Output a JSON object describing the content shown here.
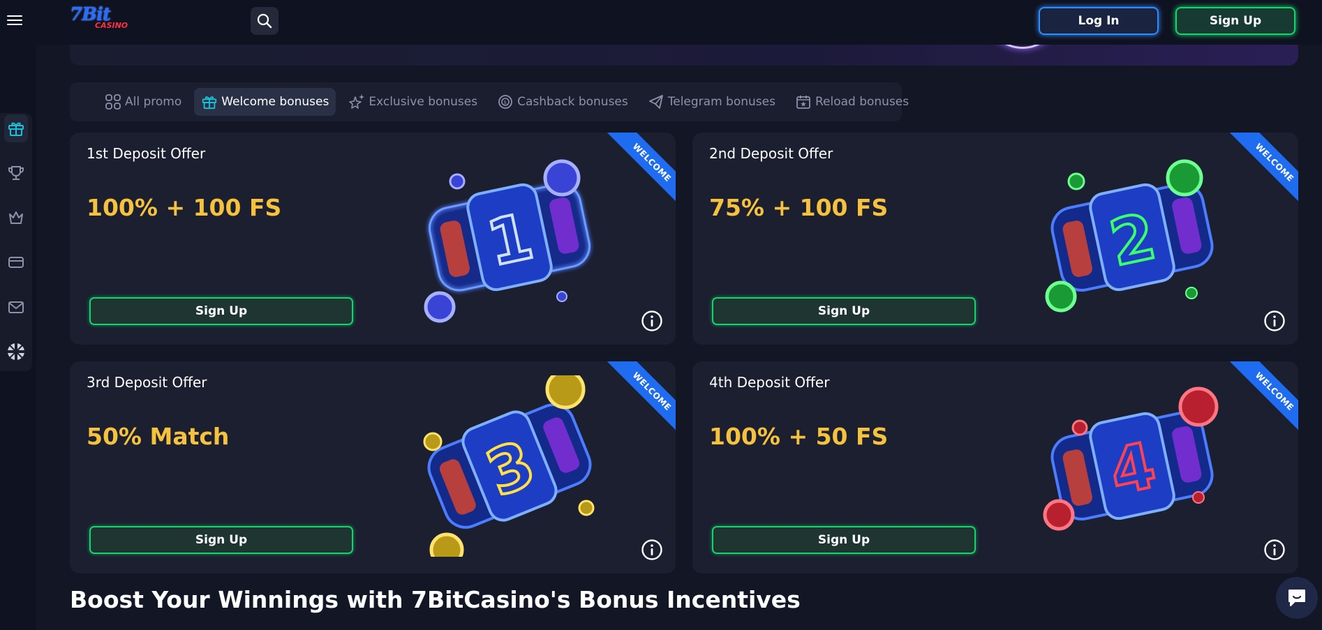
{
  "header": {
    "logo_text": "7Bit",
    "logo_sub": "CASINO",
    "login_label": "Log In",
    "signup_label": "Sign Up"
  },
  "tabs": [
    {
      "label": "All promo",
      "icon": "grid-icon",
      "active": false
    },
    {
      "label": "Welcome bonuses",
      "icon": "gift-icon",
      "active": true
    },
    {
      "label": "Exclusive bonuses",
      "icon": "star-sparkle-icon",
      "active": false
    },
    {
      "label": "Cashback bonuses",
      "icon": "cashback-icon",
      "active": false
    },
    {
      "label": "Telegram bonuses",
      "icon": "telegram-icon",
      "active": false
    },
    {
      "label": "Reload bonuses",
      "icon": "calendar-icon",
      "active": false
    }
  ],
  "cards": [
    {
      "title": "1st Deposit Offer",
      "amount": "100% + 100 FS",
      "button": "Sign Up",
      "ribbon": "WELCOME",
      "digit": "1",
      "color": "#3b5cff"
    },
    {
      "title": "2nd Deposit Offer",
      "amount": "75% + 100 FS",
      "button": "Sign Up",
      "ribbon": "WELCOME",
      "digit": "2",
      "color": "#22e04a"
    },
    {
      "title": "3rd Deposit Offer",
      "amount": "50% Match",
      "button": "Sign Up",
      "ribbon": "WELCOME",
      "digit": "3",
      "color": "#f2d027"
    },
    {
      "title": "4th Deposit Offer",
      "amount": "100% + 50 FS",
      "button": "Sign Up",
      "ribbon": "WELCOME",
      "digit": "4",
      "color": "#ff3b4a"
    }
  ],
  "sidebar": [
    {
      "icon": "gift-icon",
      "active": true
    },
    {
      "icon": "trophy-icon",
      "active": false
    },
    {
      "icon": "crown-icon",
      "active": false
    },
    {
      "icon": "card-icon",
      "active": false
    },
    {
      "icon": "mail-icon",
      "active": false
    },
    {
      "icon": "uk-flag-icon",
      "active": false
    }
  ],
  "headline": "Boost Your Winnings with 7BitCasino's Bonus Incentives",
  "colors": {
    "accent_gold": "#f6c23d",
    "accent_green": "#16d46a",
    "accent_blue": "#2f8cff",
    "ribbon_blue": "#1f6cf0"
  }
}
